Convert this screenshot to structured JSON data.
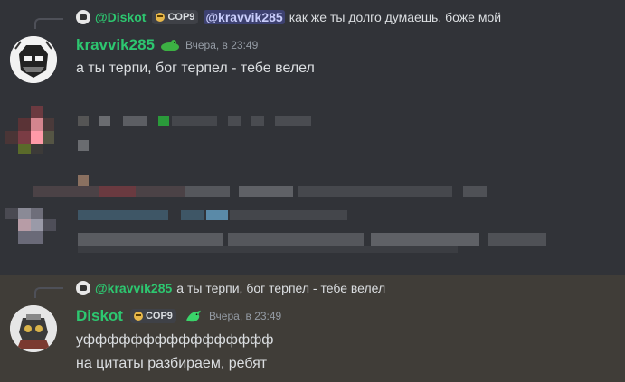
{
  "messages": [
    {
      "reply": {
        "author": "@Diskot",
        "tag": "COP9",
        "mention": "@kravvik285",
        "text": "как же ты долго думаешь, боже мой"
      },
      "author": "kravvik285",
      "author_color": "#2dc770",
      "timestamp": "Вчера, в 23:49",
      "lines": [
        "а ты терпи, бог терпел - тебе велел"
      ]
    },
    {
      "reply": {
        "author": "@kravvik285",
        "text": "а ты терпи, бог терпел - тебе велел"
      },
      "author": "Diskot",
      "author_color": "#2dc770",
      "tag": "COP9",
      "timestamp": "Вчера, в 23:49",
      "lines": [
        "уфффффффффффффффф",
        "на цитаты разбираем, ребят"
      ],
      "highlighted": true
    }
  ],
  "colors": {
    "background": "#313338",
    "highlight": "#403d38",
    "username": "#2dc770",
    "reply_author": "#2dc770"
  },
  "icons": [
    "frog-icon",
    "dragon-icon",
    "skull-icon"
  ]
}
